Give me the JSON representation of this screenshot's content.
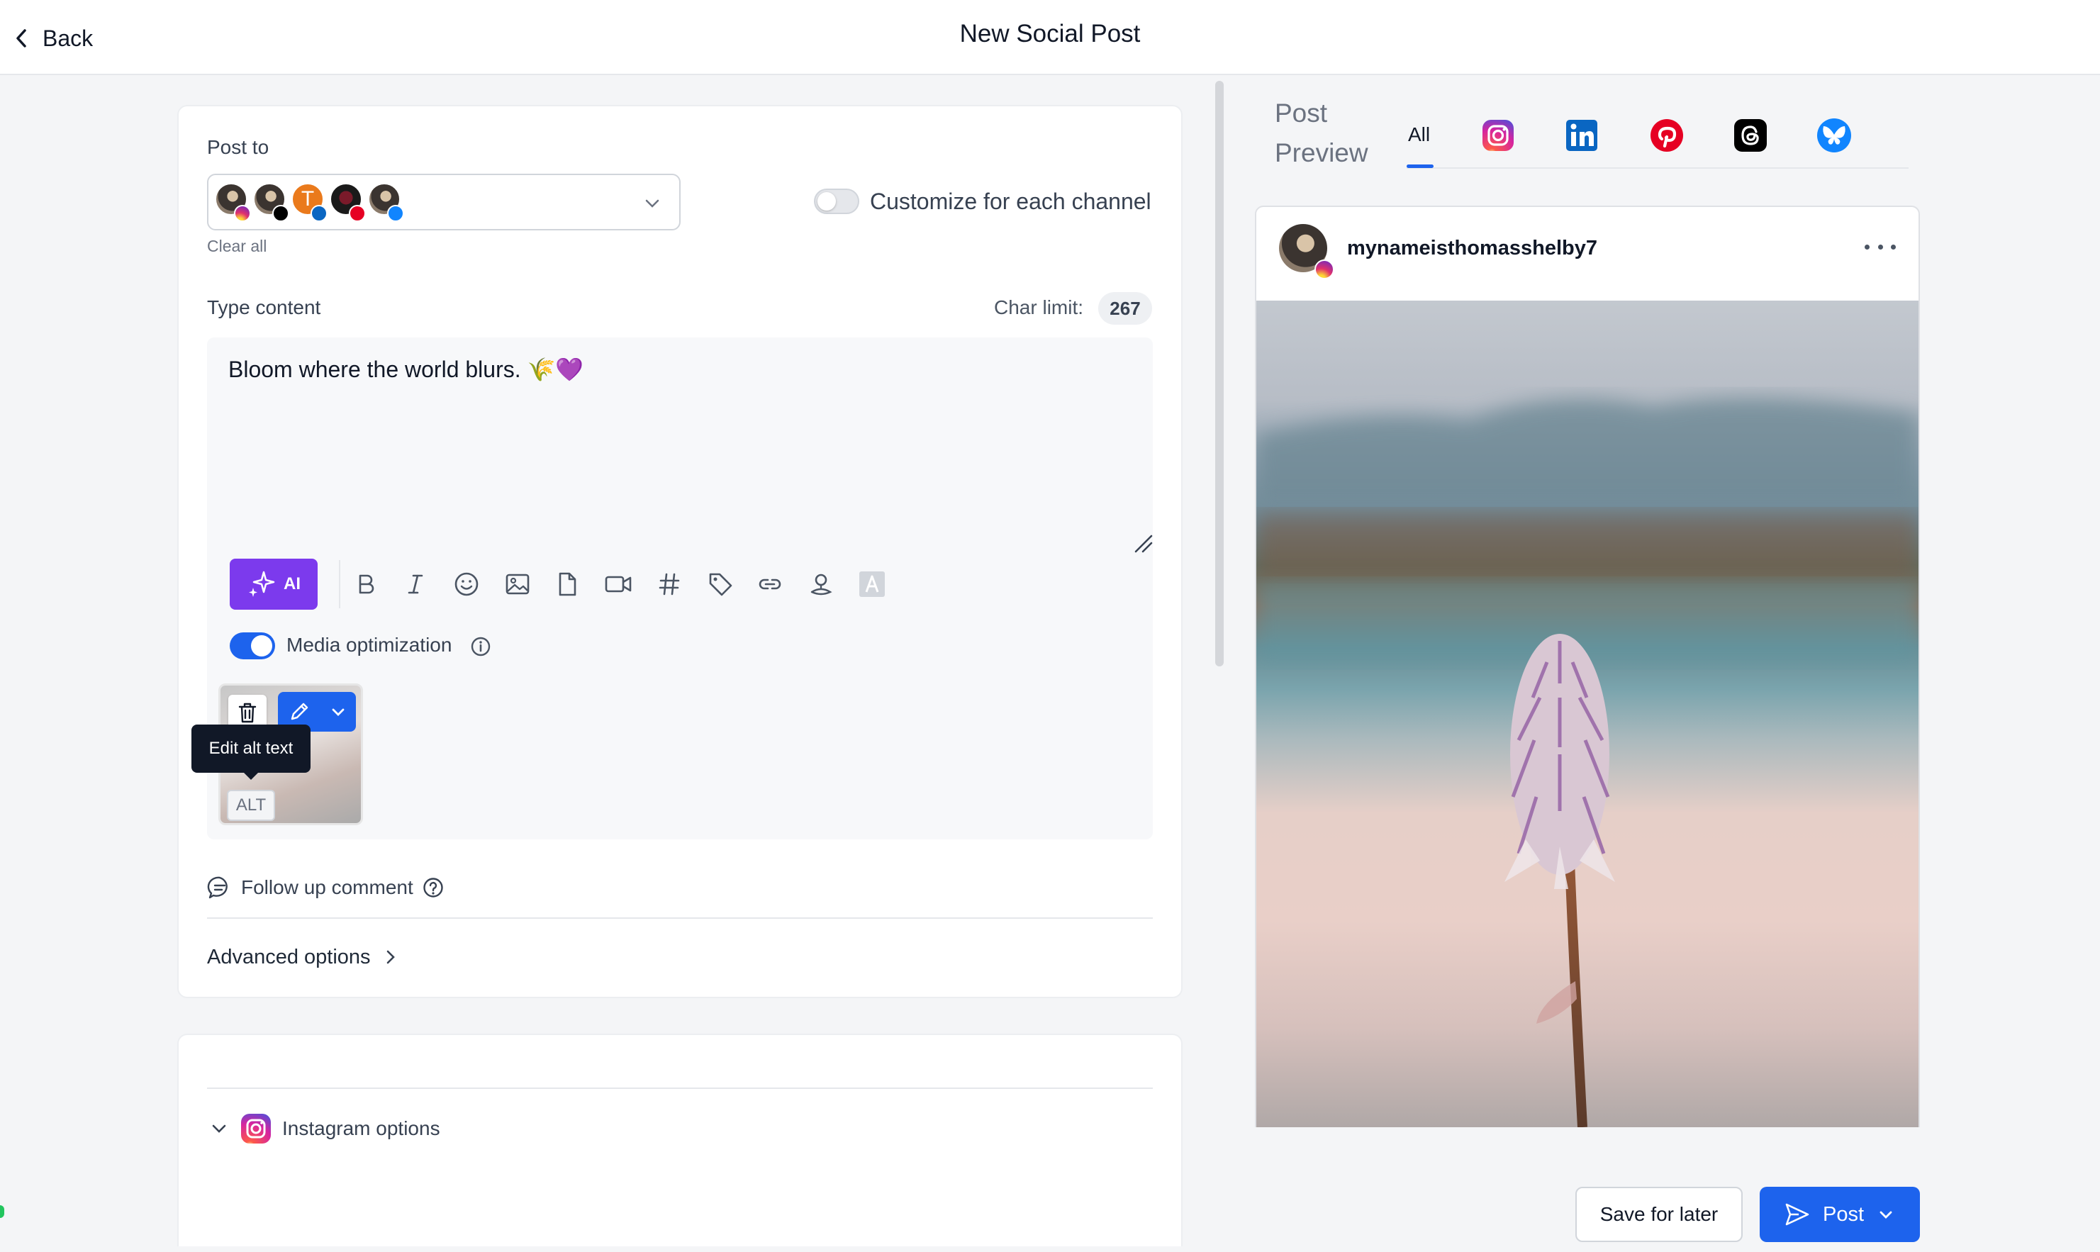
{
  "header": {
    "back_label": "Back",
    "title": "New Social Post"
  },
  "post_to": {
    "label": "Post to",
    "clear_all": "Clear all",
    "avatar_initial": "T",
    "channels": [
      "instagram",
      "threads",
      "linkedin",
      "pinterest",
      "bluesky"
    ]
  },
  "customize": {
    "label": "Customize for each channel",
    "enabled": false
  },
  "content": {
    "label": "Type content",
    "char_limit_label": "Char limit:",
    "char_limit_value": "267",
    "text": "Bloom where the world blurs. 🌾💜"
  },
  "toolbar": {
    "ai_label": "AI",
    "tools": [
      "bold-icon",
      "italic-icon",
      "emoji-icon",
      "image-icon",
      "file-icon",
      "video-icon",
      "hashtag-icon",
      "tag-icon",
      "link-icon",
      "location-icon",
      "text-style-icon"
    ]
  },
  "media": {
    "label": "Media optimization",
    "enabled": true,
    "alt_label": "ALT",
    "tooltip": "Edit alt text"
  },
  "followup": {
    "label": "Follow up comment"
  },
  "advanced": {
    "label": "Advanced options"
  },
  "instagram_options": {
    "label": "Instagram options"
  },
  "preview": {
    "title_line1": "Post",
    "title_line2": "Preview",
    "tabs": [
      "All",
      "instagram",
      "linkedin",
      "pinterest",
      "threads",
      "bluesky"
    ],
    "active_tab": "All",
    "username": "mynameisthomasshelby7"
  },
  "actions": {
    "save_later": "Save for later",
    "post": "Post"
  },
  "colors": {
    "primary": "#1d63ed",
    "ai": "#7c3aed",
    "instagram": "#e1306c",
    "linkedin": "#0a66c2",
    "pinterest": "#e60023",
    "threads": "#000000",
    "bluesky": "#1185fe"
  }
}
